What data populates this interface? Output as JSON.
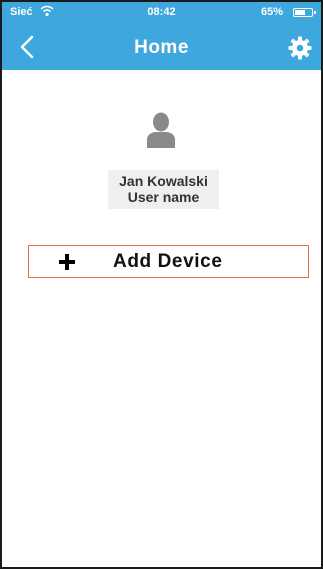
{
  "status_bar": {
    "carrier": "Sieć",
    "time": "08:42",
    "battery_percent": "65%",
    "battery_level": 0.65,
    "wifi_icon": "wifi-icon"
  },
  "nav": {
    "title": "Home",
    "back_icon": "chevron-left-icon",
    "settings_icon": "gear-icon"
  },
  "user": {
    "name": "Jan Kowalski",
    "subtitle": "User name",
    "avatar_icon": "person-icon"
  },
  "actions": {
    "add_device_label": "Add Device",
    "add_icon": "plus-icon"
  },
  "colors": {
    "header": "#3ea7dd",
    "add_border": "#e07050",
    "user_card_bg": "#efefef"
  }
}
